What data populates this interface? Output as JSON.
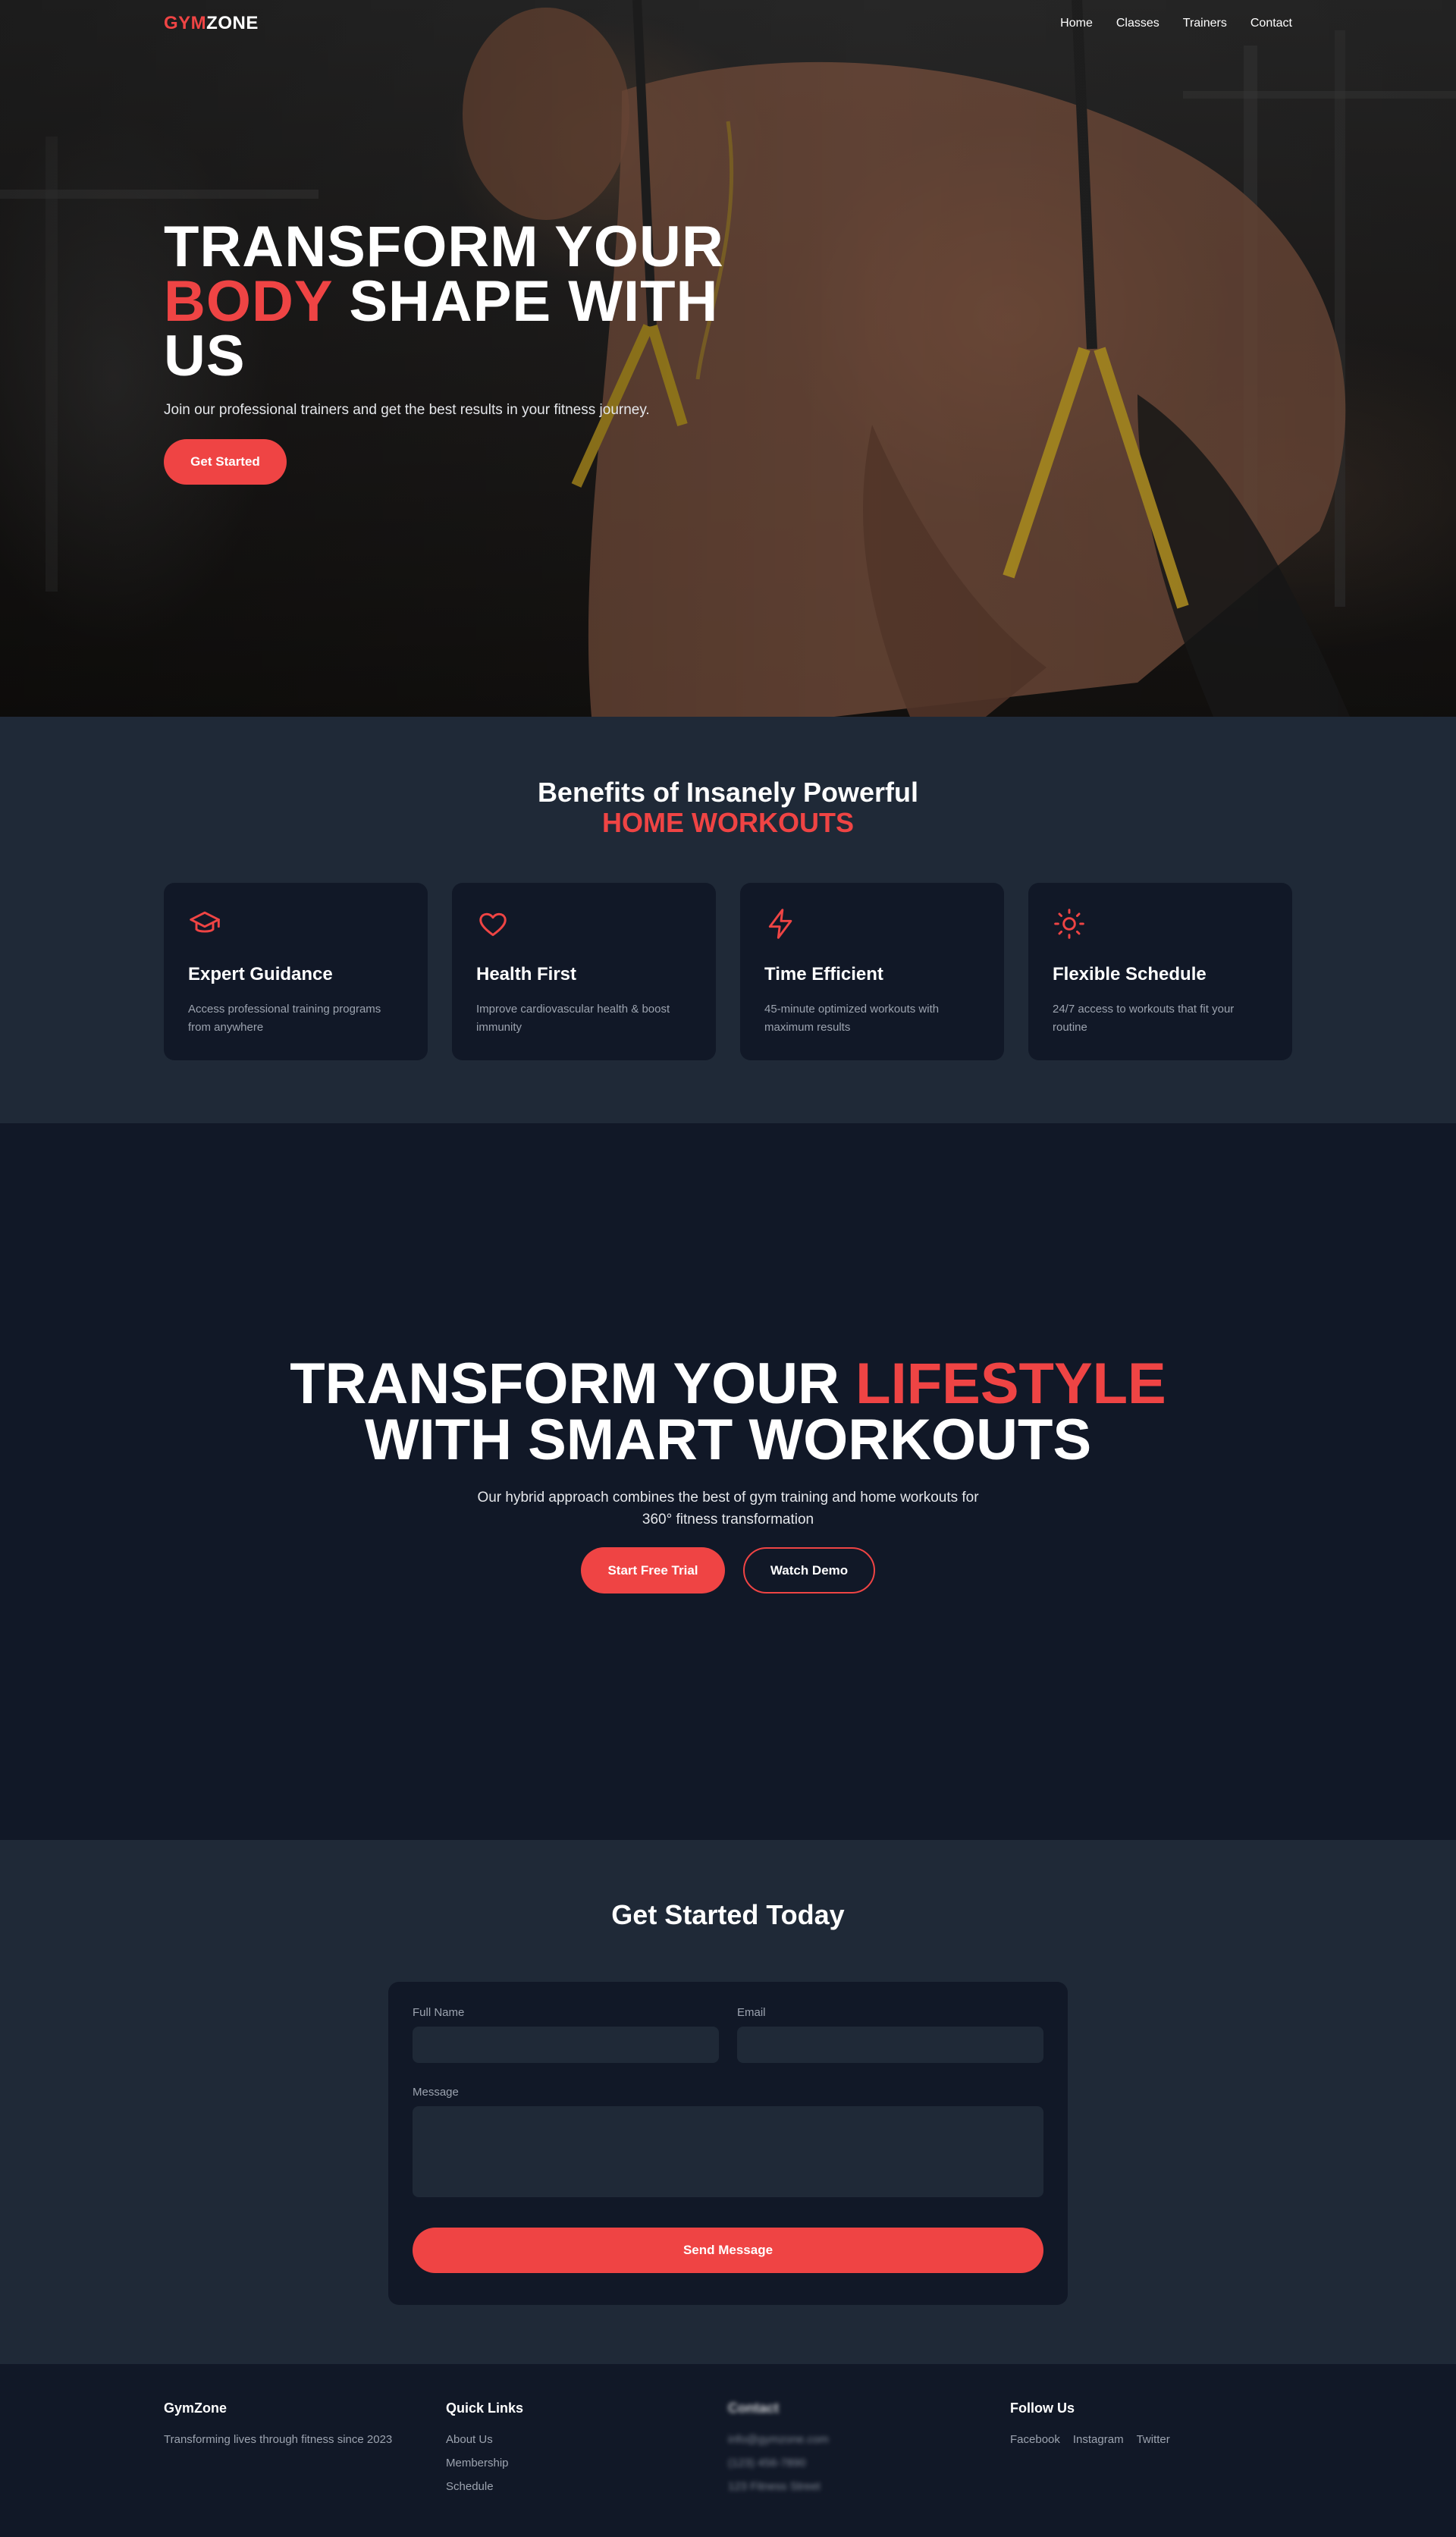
{
  "brand": {
    "part1": "GYM",
    "part2": "ZONE"
  },
  "nav": {
    "items": [
      "Home",
      "Classes",
      "Trainers",
      "Contact"
    ]
  },
  "hero": {
    "title_line1": "TRANSFORM YOUR",
    "title_red": "BODY",
    "title_line2_rest": " SHAPE WITH",
    "title_line3": "US",
    "subtitle": "Join our professional trainers and get the best results in your fitness journey.",
    "cta": "Get Started"
  },
  "benefits": {
    "title": "Benefits of Insanely Powerful",
    "title_red": "HOME WORKOUTS",
    "cards": [
      {
        "icon": "graduation-cap-icon",
        "title": "Expert Guidance",
        "text": "Access professional training programs from anywhere"
      },
      {
        "icon": "heart-icon",
        "title": "Health First",
        "text": "Improve cardiovascular health & boost immunity"
      },
      {
        "icon": "lightning-icon",
        "title": "Time Efficient",
        "text": "45-minute optimized workouts with maximum results"
      },
      {
        "icon": "sun-icon",
        "title": "Flexible Schedule",
        "text": "24/7 access to workouts that fit your routine"
      }
    ]
  },
  "lifestyle": {
    "title_start": "TRANSFORM YOUR ",
    "title_red": "LIFESTYLE",
    "title_line2": "WITH SMART WORKOUTS",
    "subtitle": "Our hybrid approach combines the best of gym training and home workouts for 360° fitness transformation",
    "btn_primary": "Start Free Trial",
    "btn_secondary": "Watch Demo"
  },
  "contact": {
    "title": "Get Started Today",
    "name_label": "Full Name",
    "email_label": "Email",
    "message_label": "Message",
    "submit": "Send Message"
  },
  "footer": {
    "brand": {
      "title": "GymZone",
      "text": "Transforming lives through fitness since 2023"
    },
    "quick_links": {
      "title": "Quick Links",
      "items": [
        "About Us",
        "Membership",
        "Schedule"
      ]
    },
    "contact": {
      "title": "Contact",
      "items": [
        "info@gymzone.com",
        "(123) 456-7890",
        "123 Fitness Street"
      ]
    },
    "follow": {
      "title": "Follow Us",
      "items": [
        "Facebook",
        "Instagram",
        "Twitter"
      ]
    }
  },
  "colors": {
    "accent": "#ef4444",
    "bg_dark": "#111827",
    "bg_section": "#1f2937",
    "muted_text": "#9ca3af"
  }
}
